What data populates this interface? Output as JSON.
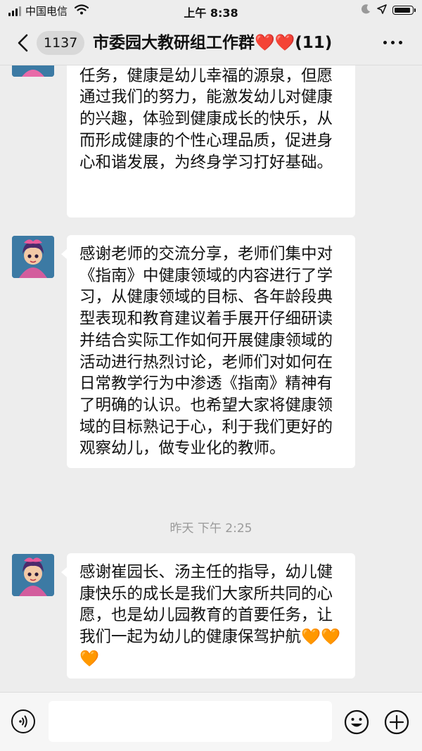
{
  "status_bar": {
    "carrier": "中国电信",
    "time": "上午 8:38"
  },
  "nav": {
    "back_badge": "1137",
    "title": "市委园大教研组工作群",
    "title_emoji": "❤️❤️",
    "member_count": "(11)"
  },
  "messages": [
    {
      "sender_avatar": "cartoon-girl-avatar",
      "text": "关注的焦点，也是幼儿园教育的首要任务，健康是幼儿幸福的源泉，但愿通过我们的努力，能激发幼儿对健康的兴趣，体验到健康成长的快乐，从而形成健康的个性心理品质，促进身心和谐发展，为终身学习打好基础。"
    },
    {
      "sender_avatar": "cartoon-girl-avatar",
      "text": "感谢老师的交流分享，老师们集中对《指南》中健康领域的内容进行了学习，从健康领域的目标、各年龄段典型表现和教育建议着手展开仔细研读并结合实际工作如何开展健康领域的活动进行热烈讨论，老师们对如何在日常教学行为中渗透《指南》精神有了明确的认识。也希望大家将健康领域的目标熟记于心，利于我们更好的观察幼儿，做专业化的教师。"
    },
    {
      "sender_avatar": "cartoon-girl-avatar",
      "text": "感谢崔园长、汤主任的指导，幼儿健康快乐的成长是我们大家所共同的心愿，也是幼儿园教育的首要任务，让我们一起为幼儿的健康保驾护航",
      "trailing_emoji": "🧡🧡🧡"
    }
  ],
  "timestamp": "昨天 下午 2:25",
  "input_bar": {
    "placeholder": ""
  }
}
